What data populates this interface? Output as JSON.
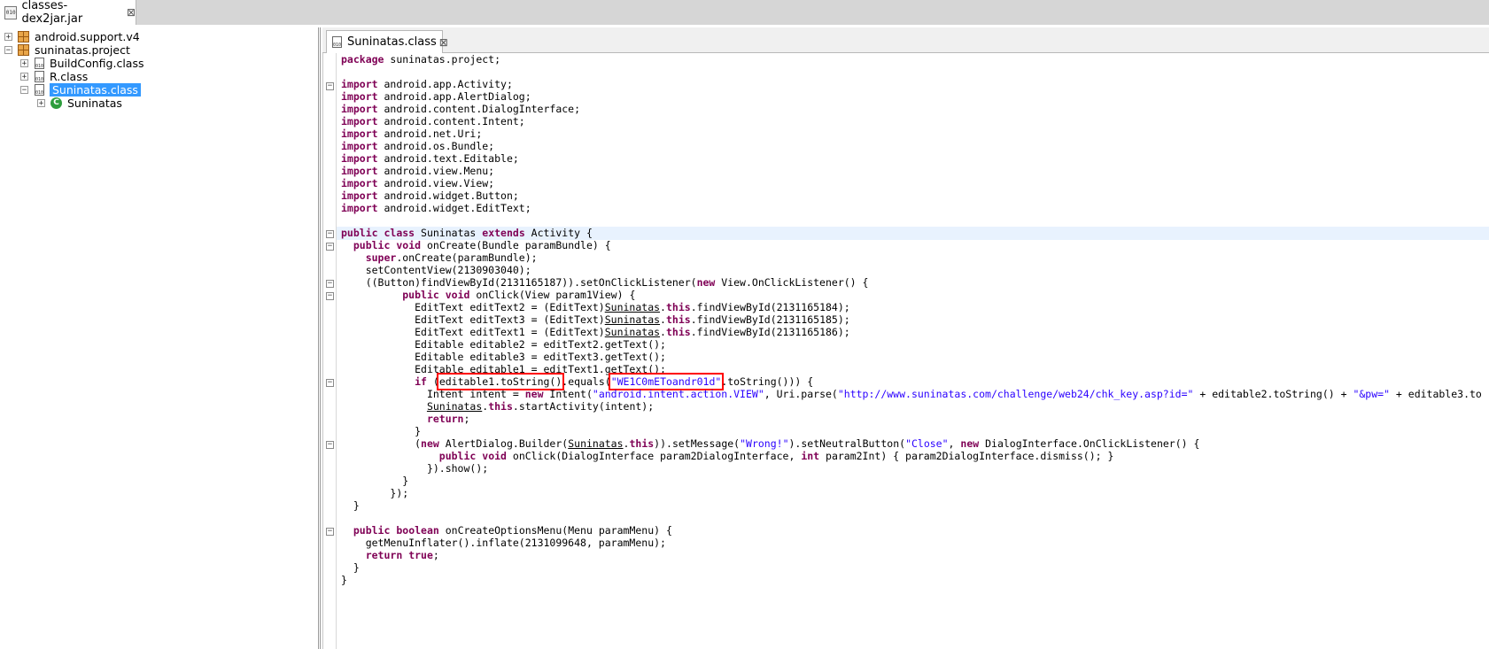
{
  "top_tab": {
    "label": "classes-dex2jar.jar",
    "close": "⊠"
  },
  "tree": {
    "items": [
      {
        "label": "android.support.v4"
      },
      {
        "label": "suninatas.project"
      },
      {
        "label": "BuildConfig.class"
      },
      {
        "label": "R.class"
      },
      {
        "label": "Suninatas.class"
      },
      {
        "label": "Suninatas"
      }
    ]
  },
  "editor_tab": {
    "label": "Suninatas.class",
    "close": "⊠"
  },
  "colors": {
    "keyword": "#7f0055",
    "string": "#2a00ff",
    "selection": "#3399ff",
    "annotation_box": "#ff0000"
  },
  "code": {
    "l0": "package",
    "l0b": " suninatas.project;",
    "imp": "import",
    "i1": " android.app.Activity;",
    "i2": " android.app.AlertDialog;",
    "i3": " android.content.DialogInterface;",
    "i4": " android.content.Intent;",
    "i5": " android.net.Uri;",
    "i6": " android.os.Bundle;",
    "i7": " android.text.Editable;",
    "i8": " android.view.Menu;",
    "i9": " android.view.View;",
    "i10": " android.widget.Button;",
    "i11": " android.widget.EditText;",
    "cls_public": "public",
    "cls_class": "class",
    "cls_name": " Suninatas ",
    "cls_extends": "extends",
    "cls_tail": " Activity {",
    "oc_pub": "public",
    "oc_void": "void",
    "oc_tail": " onCreate(Bundle paramBundle) {",
    "sup_kw": "super",
    "sup_tail": ".onCreate(paramBundle);",
    "scv": "setContentView(2130903040);",
    "btn_a": "((Button)findViewById(2131165187)).setOnClickListener(",
    "btn_new": "new",
    "btn_b": " View.OnClickListener() {",
    "click_pub": "public",
    "click_void": "void",
    "click_tail": " onClick(View param1View) {",
    "et_type": "EditText",
    "et2_a": " editText2 = (EditText)",
    "et3_a": " editText3 = (EditText)",
    "et1_a": " editText1 = (EditText)",
    "sun": "Suninatas",
    "dot": ".",
    "this_kw": "this",
    "fv184": ".findViewById(2131165184);",
    "fv185": ".findViewById(2131165185);",
    "fv186": ".findViewById(2131165186);",
    "ed2": "Editable editable2 = editText2.getText();",
    "ed3": "Editable editable3 = editText3.getText();",
    "ed1": "Editable editable1 = editText1.getText();",
    "if_kw": "if",
    "if_open": " (",
    "if_box1": "editable1.toString()",
    "if_eq": ".equals(",
    "if_box2": "\"WE1C0mEToandr01d\"",
    "if_tail": ".toString())) {",
    "intent_a": "Intent intent = ",
    "intent_new": "new",
    "intent_b": " Intent(",
    "intent_s1": "\"android.intent.action.VIEW\"",
    "intent_c": ", Uri.parse(",
    "intent_s2": "\"http://www.suninatas.com/challenge/web24/chk_key.asp?id=\"",
    "intent_d": " + editable2.toString() + ",
    "intent_s3": "\"&pw=\"",
    "intent_e": " + editable3.to",
    "start_tail": ".startActivity(intent);",
    "ret_kw": "return",
    "semi": ";",
    "close_brace": "}",
    "ad_a": "(",
    "ad_new": "new",
    "ad_b": " AlertDialog.Builder(",
    "ad_c": ")).setMessage(",
    "ad_s1": "\"Wrong!\"",
    "ad_d": ").setNeutralButton(",
    "ad_s2": "\"Close\"",
    "ad_e": ", ",
    "ad_new2": "new",
    "ad_f": " DialogInterface.OnClickListener() {",
    "dis_pub": "public",
    "dis_void": "void",
    "dis_a": " onClick(DialogInterface param2DialogInterface, ",
    "dis_int": "int",
    "dis_b": " param2Int) { param2DialogInterface.dismiss(); }",
    "show": "}).show();",
    "end_brace": "}",
    "end_listener": "});",
    "menu_pub": "public",
    "menu_bool": "boolean",
    "menu_tail": " onCreateOptionsMenu(Menu paramMenu) {",
    "inflate": "getMenuInflater().inflate(2131099648, paramMenu);",
    "ret_true": "true"
  }
}
